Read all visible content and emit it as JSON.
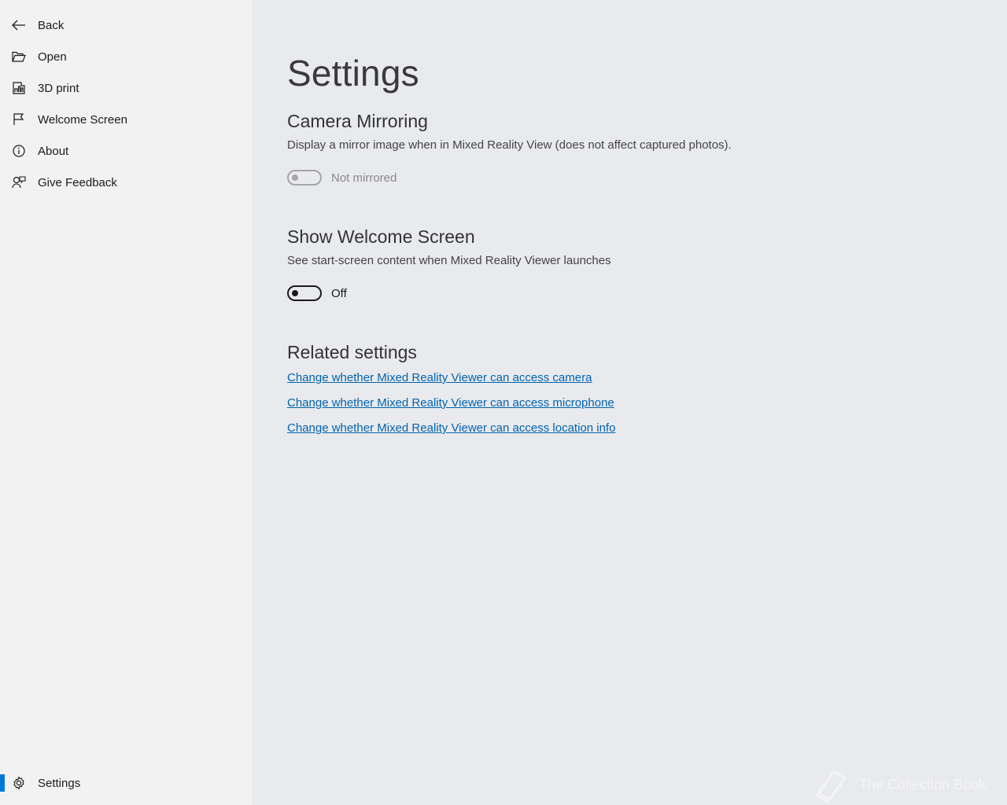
{
  "sidebar": {
    "items": [
      {
        "label": "Back",
        "icon": "back-arrow-icon"
      },
      {
        "label": "Open",
        "icon": "folder-open-icon"
      },
      {
        "label": "3D print",
        "icon": "3d-print-icon"
      },
      {
        "label": "Welcome Screen",
        "icon": "flag-icon"
      },
      {
        "label": "About",
        "icon": "info-icon"
      },
      {
        "label": "Give Feedback",
        "icon": "feedback-icon"
      }
    ],
    "settings": {
      "label": "Settings",
      "icon": "gear-icon",
      "selected": true
    },
    "accent": "#0078d7"
  },
  "page": {
    "title": "Settings",
    "camera_mirroring": {
      "title": "Camera Mirroring",
      "description": "Display a mirror image when in Mixed Reality View (does not affect captured photos).",
      "toggle_label": "Not mirrored",
      "toggle_on": false,
      "toggle_enabled": false
    },
    "welcome_screen": {
      "title": "Show Welcome Screen",
      "description": "See start-screen content when Mixed Reality Viewer launches",
      "toggle_label": "Off",
      "toggle_on": false,
      "toggle_enabled": true
    },
    "related": {
      "title": "Related settings",
      "links": [
        "Change whether Mixed Reality Viewer can access camera",
        "Change whether Mixed Reality Viewer can access microphone",
        "Change whether Mixed Reality Viewer can access location info"
      ],
      "link_color": "#0063b1"
    }
  },
  "watermark": {
    "text": "The Collection Book",
    "icon": "book-icon"
  }
}
